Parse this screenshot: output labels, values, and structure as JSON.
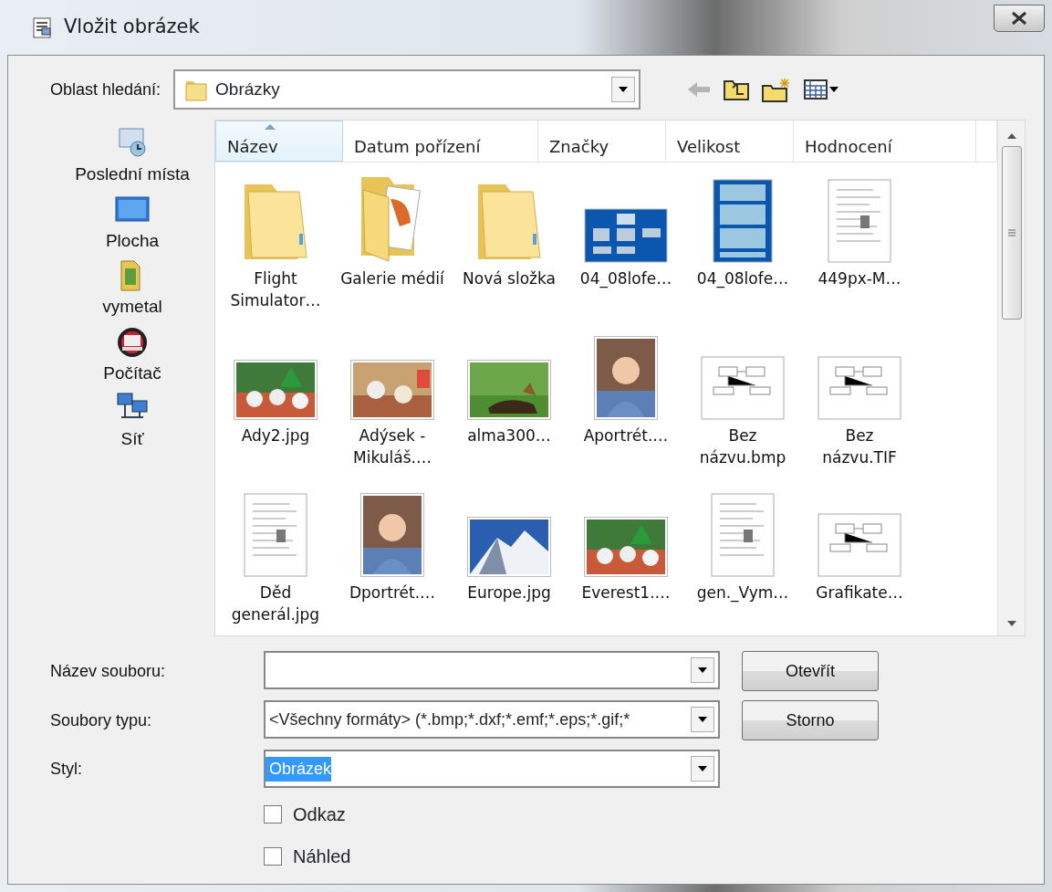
{
  "window": {
    "title": "Vložit obrázek"
  },
  "look_in": {
    "label": "Oblast hledání:",
    "value": "Obrázky"
  },
  "toolbar": [
    {
      "kind": "back",
      "disabled": true
    },
    {
      "kind": "up",
      "disabled": false
    },
    {
      "kind": "new-folder",
      "disabled": false
    },
    {
      "kind": "views",
      "disabled": false
    }
  ],
  "places": [
    {
      "kind": "recent",
      "label": "Poslední místa"
    },
    {
      "kind": "desktop",
      "label": "Plocha"
    },
    {
      "kind": "user",
      "label": "vymetal"
    },
    {
      "kind": "computer",
      "label": "Počítač"
    },
    {
      "kind": "network",
      "label": "Síť"
    }
  ],
  "columns": [
    {
      "label": "Název",
      "sorted": true
    },
    {
      "label": "Datum pořízení",
      "sorted": false
    },
    {
      "label": "Značky",
      "sorted": false
    },
    {
      "label": "Velikost",
      "sorted": false
    },
    {
      "label": "Hodnocení",
      "sorted": false
    }
  ],
  "files": [
    {
      "name": "Flight Simulator…",
      "kind": "folder"
    },
    {
      "name": "Galerie médií",
      "kind": "media-folder"
    },
    {
      "name": "Nová složka",
      "kind": "folder"
    },
    {
      "name": "04_08lofe…",
      "kind": "blue-chart"
    },
    {
      "name": "04_08lofe…",
      "kind": "blue-poster"
    },
    {
      "name": "449px-M…",
      "kind": "document"
    },
    {
      "name": "Ady2.jpg"
    },
    {
      "name": "Adýsek -Mikuláš.…"
    },
    {
      "name": "alma300…"
    },
    {
      "name": "Aportrét.…",
      "kind": "portrait"
    },
    {
      "name": "Bez názvu.bmp",
      "kind": "diagram"
    },
    {
      "name": "Bez názvu.TIF",
      "kind": "diagram"
    },
    {
      "name": "Děd generál.jpg",
      "kind": "document"
    },
    {
      "name": "Dportrét.…",
      "kind": "portrait"
    },
    {
      "name": "Europe.jpg"
    },
    {
      "name": "Everest1.…"
    },
    {
      "name": "gen._Vym…",
      "kind": "document"
    },
    {
      "name": "Grafikate…",
      "kind": "diagram"
    }
  ],
  "fields": [
    {
      "label": "Název souboru:"
    },
    {
      "label": "Soubory typu:",
      "value": "<Všechny formáty> (*.bmp;*.dxf;*.emf;*.eps;*.gif;*"
    },
    {
      "label": "Styl:",
      "value": "Obrázek",
      "highlighted": true
    }
  ],
  "buttons": [
    "Otevřít",
    "Storno"
  ],
  "checkboxes": [
    {
      "label": "Odkaz",
      "checked": false
    },
    {
      "label": "Náhled",
      "checked": false
    }
  ]
}
